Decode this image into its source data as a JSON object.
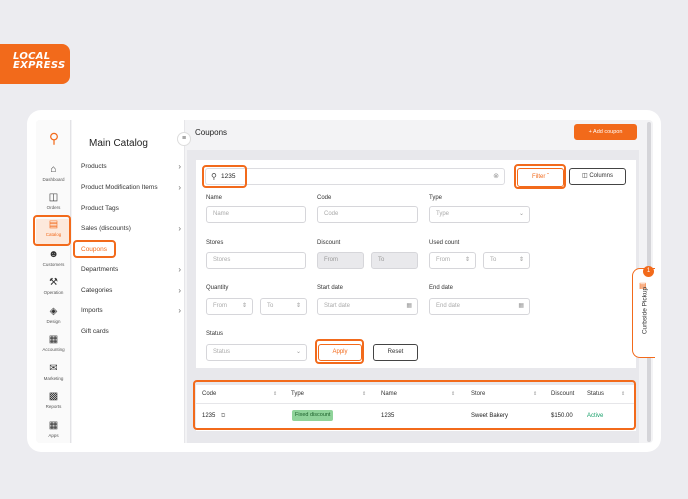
{
  "brand": {
    "logo_line1": "LOCAL",
    "logo_line2": "EXPRESS"
  },
  "nav": [
    {
      "label": "Dashboard",
      "icon": "home-icon"
    },
    {
      "label": "Orders",
      "icon": "bag-icon"
    },
    {
      "label": "Catalog",
      "icon": "catalog-icon",
      "active": true
    },
    {
      "label": "Customers",
      "icon": "customers-icon"
    },
    {
      "label": "Operation",
      "icon": "operation-icon"
    },
    {
      "label": "Design",
      "icon": "design-icon"
    },
    {
      "label": "Accounting",
      "icon": "accounting-icon"
    },
    {
      "label": "Marketing",
      "icon": "megaphone-icon"
    },
    {
      "label": "Reports",
      "icon": "reports-icon"
    },
    {
      "label": "Apps",
      "icon": "apps-icon"
    }
  ],
  "submenu": {
    "title": "Main Catalog",
    "items": [
      {
        "label": "Products",
        "chevron": true
      },
      {
        "label": "Product Modification Items",
        "chevron": true
      },
      {
        "label": "Product Tags",
        "chevron": false
      },
      {
        "label": "Sales (discounts)",
        "chevron": true
      },
      {
        "label": "Coupons",
        "chevron": false,
        "active": true
      },
      {
        "label": "Departments",
        "chevron": true
      },
      {
        "label": "Categories",
        "chevron": true
      },
      {
        "label": "Imports",
        "chevron": true
      },
      {
        "label": "Gift cards",
        "chevron": false
      }
    ]
  },
  "header": {
    "title": "Coupons",
    "add_button": "+ Add coupon"
  },
  "search": {
    "value": "1235"
  },
  "toolbar": {
    "filter_label": "Filter",
    "columns_label": "Columns"
  },
  "filters": {
    "name": {
      "label": "Name",
      "placeholder": "Name"
    },
    "code": {
      "label": "Code",
      "placeholder": "Code"
    },
    "type": {
      "label": "Type",
      "placeholder": "Type"
    },
    "stores": {
      "label": "Stores",
      "placeholder": "Stores"
    },
    "discount": {
      "label": "Discount",
      "from": "From",
      "to": "To"
    },
    "used_count": {
      "label": "Used count",
      "from": "From",
      "to": "To"
    },
    "quantity": {
      "label": "Quantity",
      "from": "From",
      "to": "To"
    },
    "start_date": {
      "label": "Start date",
      "placeholder": "Start date"
    },
    "end_date": {
      "label": "End date",
      "placeholder": "End date"
    },
    "status": {
      "label": "Status",
      "placeholder": "Status"
    },
    "apply_label": "Apply",
    "reset_label": "Reset"
  },
  "table": {
    "columns": [
      "Code",
      "Type",
      "Name",
      "Store",
      "Discount",
      "Status"
    ],
    "rows": [
      {
        "code": "1235",
        "type": "Fixed discount",
        "name": "1235",
        "store": "Sweet Bakery",
        "discount": "$150.00",
        "status": "Active"
      }
    ]
  },
  "curbside": {
    "label": "Curbside Pickup",
    "badge": "1"
  },
  "colors": {
    "accent": "#f26a1b",
    "active_status": "#1aa06b",
    "badge_bg": "#8fd39a"
  }
}
